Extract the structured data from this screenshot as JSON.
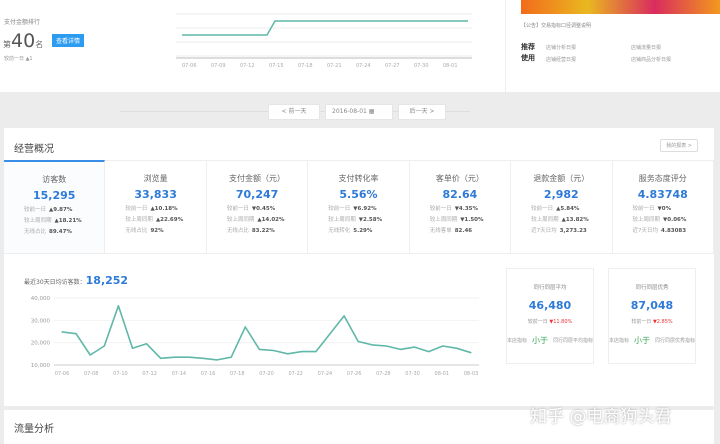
{
  "rank": {
    "title": "支付金额排行",
    "prefix": "第",
    "value": "40",
    "suffix": "名",
    "button": "查看详情",
    "sub": "较前一日 ▲1"
  },
  "top_chart": {
    "x": [
      "07-06",
      "07-09",
      "07-12",
      "07-15",
      "07-18",
      "07-21",
      "07-24",
      "07-27",
      "07-30",
      "08-01"
    ],
    "values": [
      1,
      1,
      1,
      1,
      2,
      2,
      2,
      2,
      2,
      2,
      2
    ]
  },
  "notice": {
    "text": "【公告】交易指标口径调整说明",
    "recommend_label_1": "推荐",
    "recommend_label_2": "使用",
    "links": [
      "店铺分析日报",
      "店铺流量日报",
      "店铺经营日报",
      "店铺商品分析日报"
    ]
  },
  "date_nav": {
    "prev": "< 前一天",
    "date": "2016-08-01",
    "next": "后一天 >"
  },
  "overview": {
    "title": "经营概况",
    "button": "我的报表 >",
    "metrics": [
      {
        "label": "访客数",
        "value": "15,295",
        "r1l": "较前一日",
        "r1": "▲9.87%",
        "r1d": "up",
        "r2l": "较上周同期",
        "r2": "▲18.21%",
        "r2d": "up",
        "r3l": "无线占比",
        "r3": "89.47%"
      },
      {
        "label": "浏览量",
        "value": "33,833",
        "r1l": "较前一日",
        "r1": "▲10.18%",
        "r1d": "up",
        "r2l": "较上周同期",
        "r2": "▲22.69%",
        "r2d": "up",
        "r3l": "无线占比",
        "r3": "92%"
      },
      {
        "label": "支付金额（元）",
        "value": "70,247",
        "r1l": "较前一日",
        "r1": "▼0.45%",
        "r1d": "down",
        "r2l": "较上周同期",
        "r2": "▲14.02%",
        "r2d": "up",
        "r3l": "无线占比",
        "r3": "83.22%"
      },
      {
        "label": "支付转化率",
        "value": "5.56%",
        "r1l": "较前一日",
        "r1": "▼6.92%",
        "r1d": "down",
        "r2l": "较上周同期",
        "r2": "▼2.58%",
        "r2d": "down",
        "r3l": "无线转化",
        "r3": "5.29%"
      },
      {
        "label": "客单价（元）",
        "value": "82.64",
        "r1l": "较前一日",
        "r1": "▼4.35%",
        "r1d": "down",
        "r2l": "较上周同期",
        "r2": "▼1.50%",
        "r2d": "down",
        "r3l": "无线客单",
        "r3": "82.46"
      },
      {
        "label": "退款金额（元）",
        "value": "2,982",
        "r1l": "较前一日",
        "r1": "▲5.84%",
        "r1d": "up",
        "r2l": "较上周同期",
        "r2": "▲13.82%",
        "r2d": "up",
        "r3l": "近7天日均",
        "r3": "3,273.23"
      },
      {
        "label": "服务态度评分",
        "value": "4.83748",
        "r1l": "较前一日",
        "r1": "▼0%",
        "r1d": "down",
        "r2l": "较上周同期",
        "r2": "▼0.06%",
        "r2d": "down",
        "r3l": "近7天日均",
        "r3": "4.83083"
      }
    ]
  },
  "avg": {
    "label": "最近30天日均访客数：",
    "value": "18,252"
  },
  "chart_data": {
    "type": "line",
    "title": "最近30天日均访客数",
    "ylim": [
      10000,
      40000
    ],
    "yticks": [
      "40,000",
      "30,000",
      "20,000",
      "10,000"
    ],
    "categories": [
      "07-06",
      "07-08",
      "07-10",
      "07-12",
      "07-14",
      "07-16",
      "07-18",
      "07-20",
      "07-22",
      "07-24",
      "07-26",
      "07-28",
      "07-30",
      "08-01",
      "08-03"
    ],
    "values": [
      24800,
      24000,
      14500,
      18500,
      36500,
      17500,
      19500,
      13000,
      13500,
      13500,
      13000,
      12300,
      13500,
      27000,
      17000,
      16500,
      15000,
      16000,
      16000,
      24000,
      32000,
      20500,
      19000,
      18500,
      17000,
      18000,
      16000,
      18500,
      17500,
      15500
    ]
  },
  "compare": [
    {
      "title": "同行同层平均",
      "value": "46,480",
      "change_label": "较前一日",
      "change": "▼11.80%",
      "left": "本店指标",
      "mid": "小于",
      "right": "同行同层平均指标"
    },
    {
      "title": "同行同层优秀",
      "value": "87,048",
      "change_label": "较前一日",
      "change": "▼2.85%",
      "left": "本店指标",
      "mid": "小于",
      "right": "同行同层优秀指标"
    }
  ],
  "flow": {
    "title": "流量分析"
  },
  "watermark": "知乎 @电商狗头君"
}
